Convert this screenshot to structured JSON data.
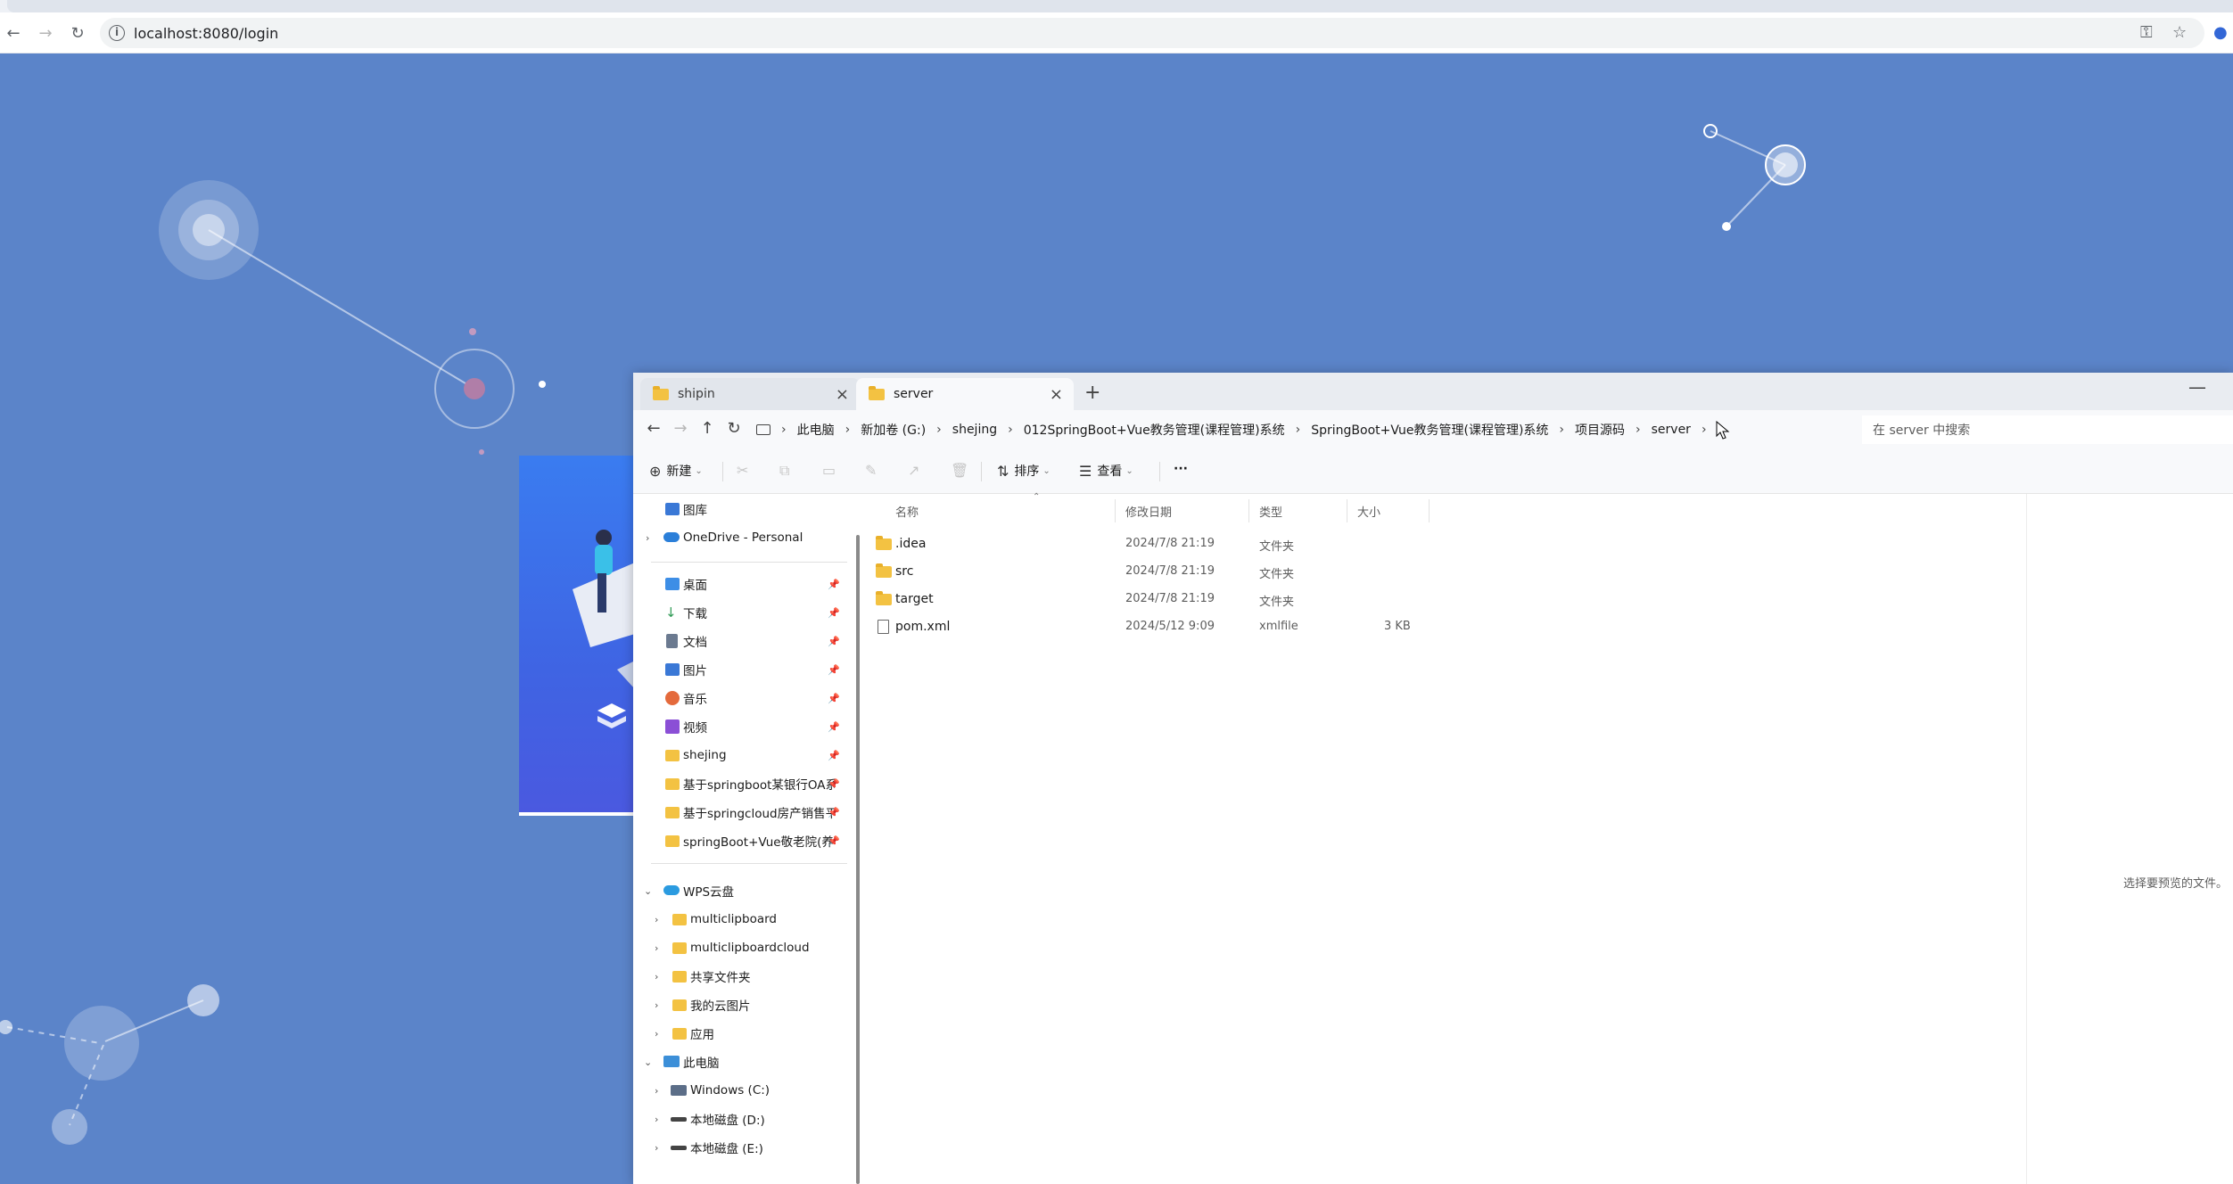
{
  "browser": {
    "url": "localhost:8080/login"
  },
  "explorer": {
    "tabs": [
      {
        "label": "shipin"
      },
      {
        "label": "server"
      }
    ],
    "breadcrumbs": [
      "此电脑",
      "新加卷 (G:)",
      "shejing",
      "012SpringBoot+Vue教务管理(课程管理)系统",
      "SpringBoot+Vue教务管理(课程管理)系统",
      "项目源码",
      "server"
    ],
    "search_placeholder": "在 server 中搜索",
    "toolbar": {
      "new_label": "新建",
      "sort_label": "排序",
      "view_label": "查看",
      "more_label": "···"
    },
    "nav": {
      "gallery": "图库",
      "onedrive": "OneDrive - Personal",
      "quick": [
        {
          "label": "桌面",
          "color": "#3d8ee6"
        },
        {
          "label": "下载",
          "color": "#2f9a55"
        },
        {
          "label": "文档",
          "color": "#6b7a90"
        },
        {
          "label": "图片",
          "color": "#3a78d6"
        },
        {
          "label": "音乐",
          "color": "#e46a3c"
        },
        {
          "label": "视频",
          "color": "#8b4fd6"
        },
        {
          "label": "shejing",
          "color": "#f3c242"
        },
        {
          "label": "基于springboot某银行OA系统",
          "color": "#f3c242"
        },
        {
          "label": "基于springcloud房产销售平台",
          "color": "#f3c242"
        },
        {
          "label": "springBoot+Vue敬老院(养老院",
          "color": "#f3c242"
        }
      ],
      "wps": "WPS云盘",
      "wps_items": [
        "multiclipboard",
        "multiclipboardcloud",
        "共享文件夹",
        "我的云图片",
        "应用"
      ],
      "thispc": "此电脑",
      "drives": [
        "Windows (C:)",
        "本地磁盘 (D:)",
        "本地磁盘 (E:)"
      ]
    },
    "columns": {
      "name": "名称",
      "modified": "修改日期",
      "type": "类型",
      "size": "大小"
    },
    "files": [
      {
        "name": ".idea",
        "modified": "2024/7/8 21:19",
        "type": "文件夹",
        "size": "",
        "kind": "folder"
      },
      {
        "name": "src",
        "modified": "2024/7/8 21:19",
        "type": "文件夹",
        "size": "",
        "kind": "folder"
      },
      {
        "name": "target",
        "modified": "2024/7/8 21:19",
        "type": "文件夹",
        "size": "",
        "kind": "folder"
      },
      {
        "name": "pom.xml",
        "modified": "2024/5/12 9:09",
        "type": "xmlfile",
        "size": "3 KB",
        "kind": "file"
      }
    ],
    "preview_hint": "选择要预览的文件。"
  }
}
